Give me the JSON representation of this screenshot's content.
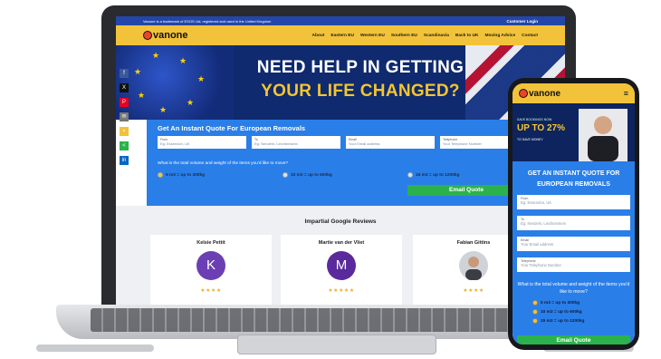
{
  "laptop": {
    "topbar": {
      "notice": "Vanone is a trademark of ESOS Ltd, registered and used in the United Kingdom",
      "login": "Customer Login"
    },
    "logo": "vanone",
    "menu": [
      "About",
      "Eastern EU",
      "Western EU",
      "Southern EU",
      "Scandinavia",
      "Back to UK",
      "Moving Advice",
      "Contact"
    ],
    "hero": {
      "line1": "NEED HELP IN GETTING",
      "line2": "YOUR LIFE CHANGED?"
    },
    "social_icons": [
      "facebook-icon",
      "x-icon",
      "pinterest-icon",
      "email-icon",
      "sms-icon",
      "share-icon",
      "linkedin-icon"
    ],
    "quote": {
      "title": "Get An Instant Quote For European Removals",
      "fields": [
        {
          "caption": "From",
          "placeholder": "Eg: Essendon, UK"
        },
        {
          "caption": "To",
          "placeholder": "Eg: Nendeln, Liechtenstein"
        },
        {
          "caption": "Email",
          "placeholder": "Your Email address"
        },
        {
          "caption": "Telephone",
          "placeholder": "Your Telephone Number"
        }
      ],
      "question": "What is the total volume and weight of the items you'd like to move?",
      "options": [
        "5 m3 = up to 300kg",
        "10 m3 = up to 600kg",
        "15 m3 = up to 1200kg"
      ],
      "button": "Email Quote"
    },
    "reviews": {
      "title": "Impartial Google Reviews",
      "items": [
        {
          "name": "Kelsie Pettit",
          "initial": "K",
          "stars": "★★★★"
        },
        {
          "name": "Martie van der Vliet",
          "initial": "M",
          "stars": "★★★★★"
        },
        {
          "name": "Fabian Gittins",
          "initial": "",
          "stars": "★★★★"
        }
      ],
      "avatar_color": "#6b3fb3"
    }
  },
  "phone": {
    "logo": "vanone",
    "menu_icon": "hamburger-icon",
    "promo": {
      "small": "SAVE BOOKINGS NOW",
      "big": "UP TO 27%",
      "small2": "TO SAVE MONEY"
    },
    "quote": {
      "title": "GET AN INSTANT QUOTE FOR EUROPEAN REMOVALS",
      "fields": [
        {
          "caption": "From",
          "placeholder": "Eg: Essendon, UK"
        },
        {
          "caption": "To",
          "placeholder": "Eg: Nendeln, Liechtenstein"
        },
        {
          "caption": "Email",
          "placeholder": "Your Email address"
        },
        {
          "caption": "Telephone",
          "placeholder": "Your Telephone Number"
        }
      ],
      "question": "What is the total volume and weight of the items you'd like to move?",
      "options": [
        "5 m3 = up to 300kg",
        "10 m3 = up to 600kg",
        "15 m3 = up to 1200kg"
      ],
      "button": "Email Quote"
    }
  },
  "colors": {
    "brand_yellow": "#f2c33a",
    "brand_blue": "#2a7ee8",
    "dark_navy": "#0f2a6e",
    "cta_green": "#2bb24c"
  }
}
